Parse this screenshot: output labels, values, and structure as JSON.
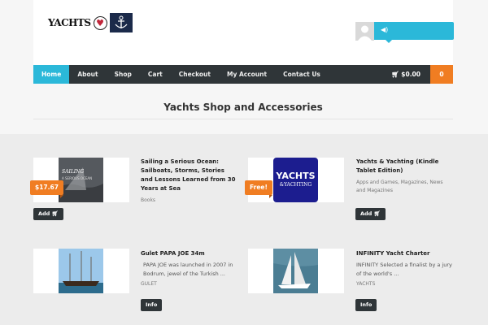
{
  "header": {
    "logo_text": "YACHTS",
    "user_bar_icon": "volume-icon"
  },
  "nav": {
    "items": [
      "Home",
      "About",
      "Shop",
      "Cart",
      "Checkout",
      "My Account",
      "Contact Us"
    ],
    "active": "Home",
    "cart_total": "$0.00",
    "cart_count": "0"
  },
  "main": {
    "title": "Yachts Shop and Accessories"
  },
  "products": [
    {
      "title": "Sailing a Serious Ocean: Sailboats, Storms, Stories and Lessons Learned from 30 Years at Sea",
      "category": "Books",
      "price": "$17.67",
      "button": "Add",
      "image_text": "SAILING A SERIOUS OCEAN"
    },
    {
      "title": "Yachts & Yachting (Kindle Tablet Edition)",
      "category": "Apps and Games, Magazines, News and Magazines",
      "price": "Free!",
      "button": "Add",
      "image_text": "YACHTS & YACHTING"
    },
    {
      "title": "Gulet PAPA JOE 34m",
      "description": "PAPA JOE was launched in 2007 in Bodrum, jewel of the Turkish ...",
      "category": "GULET",
      "button": "Info"
    },
    {
      "title": "INFINITY Yacht Charter",
      "description": "INFINITY Selected a finalist by a jury of the world's ...",
      "category": "YACHTS",
      "button": "Info"
    }
  ],
  "colors": {
    "accent": "#2bb8d9",
    "orange": "#f07d22",
    "nav_bg": "#2f3538"
  }
}
